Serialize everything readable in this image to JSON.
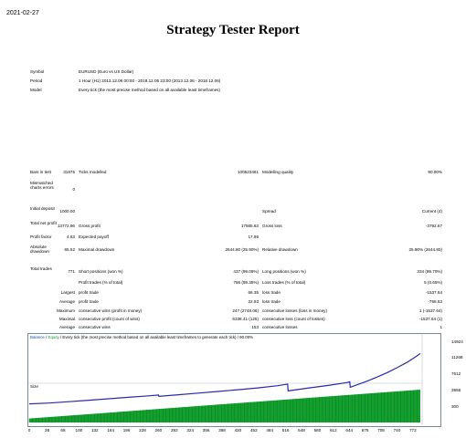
{
  "report": {
    "date": "2021-02-27",
    "title": "Strategy Tester Report"
  },
  "meta": [
    {
      "label": "Symbol",
      "value": "EURUSD (Euro vs US Dollar)"
    },
    {
      "label": "Period",
      "value": "1 Hour (H1) 2013.12.06 00:00 - 2018.12.05 23:00 (2013.12.06 - 2018.12.06)"
    },
    {
      "label": "Model",
      "value": "Every tick (the most precise method based on all available least timeframes)"
    }
  ],
  "stats": {
    "bars_label": "Bars in test",
    "bars_value": "31975",
    "ticks_label": "Ticks modelled",
    "ticks_value": "100523461",
    "quality_label": "Modelling quality",
    "quality_value": "90.00%",
    "mismatched_label": "Mismatched charts errors",
    "mismatched_value": "0",
    "deposit_label": "Initial deposit",
    "deposit_value": "1000.00",
    "spread_label": "Spread",
    "spread_value": "Current (4)",
    "netprofit_label": "Total net profit",
    "netprofit_value": "13772.96",
    "grossprofit_label": "Gross profit",
    "grossprofit_value": "17565.63",
    "grossloss_label": "Gross loss",
    "grossloss_value": "-3792.67",
    "pf_label": "Profit factor",
    "pf_value": "4.63",
    "payoff_label": "Expected payoff",
    "payoff_value": "17.86",
    "absdd_label": "Absolute drawdown",
    "absdd_value": "65.52",
    "maxdd_label": "Maximal drawdown",
    "maxdd_value": "2644.80 (25.90%)",
    "reldd_label": "Relative drawdown",
    "reldd_value": "25.90% (2644.80)",
    "trades_label": "Total trades",
    "trades_value": "771",
    "short_label": "Short positions (won %)",
    "short_value": "437 (99.08%)",
    "long_label": "Long positions (won %)",
    "long_value": "334 (99.70%)",
    "ptrades_label": "Profit trades (% of total)",
    "ptrades_value": "766 (99.35%)",
    "ltrades_label": "Loss trades (% of total)",
    "ltrades_value": "5 (0.65%)",
    "largest_label": "Largest",
    "largest_p_label": "profit trade",
    "largest_p_value": "66.35",
    "largest_l_label": "loss trade",
    "largest_l_value": "-1537.64",
    "average_label": "Average",
    "average_p_label": "profit trade",
    "average_p_value": "22.93",
    "average_l_label": "loss trade",
    "average_l_value": "-758.53",
    "maximum_label": "Maximum",
    "maxwins_label": "consecutive wins (profit in money)",
    "maxwins_value": "247 (2748.06)",
    "maxlosses_label": "consecutive losses (loss in money)",
    "maxlosses_value": "1 (-1537.64)",
    "maximal_label": "Maximal",
    "maxprofit_label": "consecutive profit (count of wins)",
    "maxprofit_value": "6338.41 (125)",
    "maxloss_label": "consecutive loss (count of losses)",
    "maxloss_value": "-1537.64 (1)",
    "avg2_label": "Average",
    "avgwins_label": "consecutive wins",
    "avgwins_value": "153",
    "avglosses_label": "consecutive losses",
    "avglosses_value": "1"
  },
  "chart_data": {
    "type": "line",
    "legend": {
      "balance": "Balance",
      "sep1": " / ",
      "equity": "Equity",
      "rest": " / Every tick (the most precise method based on all available least timeframes to generate each tick) / 90.00%"
    },
    "colors": {
      "balance": "#2a2aa8",
      "equity": "#1a9a3a",
      "size": "#13a02e"
    },
    "y_ticks": [
      "14924",
      "11268",
      "7612",
      "3956",
      "300"
    ],
    "size_label": "Size",
    "x_ticks": [
      "0",
      "36",
      "68",
      "100",
      "132",
      "164",
      "196",
      "228",
      "260",
      "292",
      "324",
      "356",
      "388",
      "420",
      "452",
      "484",
      "516",
      "548",
      "580",
      "612",
      "644",
      "676",
      "708",
      "740",
      "772"
    ],
    "xlim": [
      0,
      787
    ],
    "ylim": [
      300,
      14924
    ],
    "balance": [
      [
        0,
        1000
      ],
      [
        40,
        1180
      ],
      [
        80,
        1500
      ],
      [
        120,
        1820
      ],
      [
        160,
        2150
      ],
      [
        200,
        2480
      ],
      [
        240,
        2810
      ],
      [
        260,
        3000
      ],
      [
        261,
        2680
      ],
      [
        300,
        3060
      ],
      [
        340,
        3430
      ],
      [
        380,
        3810
      ],
      [
        420,
        4190
      ],
      [
        460,
        4600
      ],
      [
        500,
        5100
      ],
      [
        520,
        5460
      ],
      [
        521,
        3920
      ],
      [
        560,
        4550
      ],
      [
        600,
        5150
      ],
      [
        640,
        5830
      ],
      [
        645,
        5980
      ],
      [
        646,
        4740
      ],
      [
        680,
        6120
      ],
      [
        700,
        7050
      ],
      [
        720,
        8050
      ],
      [
        740,
        9150
      ],
      [
        760,
        10360
      ],
      [
        780,
        11820
      ],
      [
        787,
        12400
      ]
    ],
    "size_values": [
      0.12,
      1.0
    ]
  }
}
